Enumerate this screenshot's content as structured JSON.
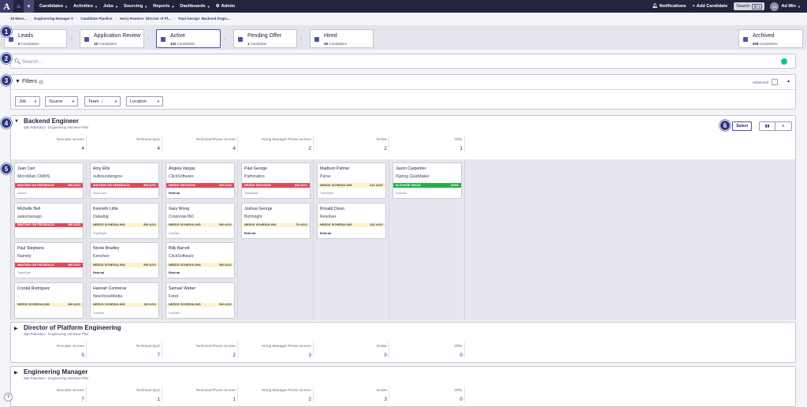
{
  "nav": {
    "logo": "A",
    "home_icon": "home-icon",
    "items": [
      "Candidates",
      "Activities",
      "Jobs",
      "Sourcing",
      "Reports",
      "Dashboards",
      "Admin"
    ],
    "notifications": "Notifications",
    "add_candidate": "Add Candidate",
    "search_label": "Search",
    "search_shortcut": "⌘+K",
    "user_initials": "AD",
    "user_name": "Ad Min"
  },
  "breadcrumb": [
    "16 More...",
    "Engineering Manager II",
    "Candidate Pipeline",
    "Harry Romero: Director of Pl...",
    "Paul George: Backend Engin..."
  ],
  "stages": [
    {
      "name": "Leads",
      "count": "0",
      "unit": "Candidates"
    },
    {
      "name": "Application Review",
      "count": "15",
      "unit": "Candidates"
    },
    {
      "name": "Active",
      "count": "122",
      "unit": "Candidates"
    },
    {
      "name": "Pending Offer",
      "count": "1",
      "unit": "Candidate"
    },
    {
      "name": "Hired",
      "count": "39",
      "unit": "Candidates"
    },
    {
      "name": "Archived",
      "count": "928",
      "unit": "Candidates"
    }
  ],
  "badges": [
    "1",
    "2",
    "3",
    "4",
    "5",
    "6"
  ],
  "search": {
    "placeholder": "Search..."
  },
  "filters": {
    "title": "Filters",
    "advanced": "Advanced",
    "dropdowns": [
      "Job",
      "Source",
      "Team",
      "Location"
    ]
  },
  "stage_headers": [
    "Recruiter Screen",
    "Technical Quiz",
    "Technical Phone Screen",
    "Hiring Manager Phone Screen",
    "Onsite",
    "Offer"
  ],
  "jobs": [
    {
      "title": "Backend Engineer",
      "location": "San Francisco",
      "plan": "Engineering Interview Plan",
      "counts": [
        "4",
        "4",
        "4",
        "2",
        "2",
        "1"
      ]
    },
    {
      "title": "Director of Platform Engineering",
      "location": "San Francisco",
      "plan": "Engineering Interview Plan",
      "counts": [
        "5",
        "7",
        "2",
        "3",
        "0",
        "0"
      ]
    },
    {
      "title": "Engineering Manager",
      "location": "San Francisco",
      "plan": "Engineering Interview Plan",
      "counts": [
        "7",
        "1",
        "1",
        "2",
        "3",
        "0"
      ]
    }
  ],
  "select_label": "Select",
  "board": [
    [
      {
        "name": "Juan Carr",
        "company": "MicroMain CMMS",
        "status": "WAITING ON FEEDBACK",
        "age": "5W AGO",
        "tone": "red",
        "source": "Indeed"
      },
      {
        "name": "Michelle Bell",
        "company": "salesmanago",
        "status": "WAITING ON FEEDBACK",
        "age": "5W AGO",
        "tone": "red",
        "source": ""
      },
      {
        "name": "Paul Stephens",
        "company": "Namely",
        "status": "WAITING ON FEEDBACK",
        "age": "5W AGO",
        "tone": "red",
        "source": "TripleByte"
      },
      {
        "name": "Crystal Rodriguez",
        "company": "-",
        "status": "NEEDS SCHEDULING",
        "age": "4W AGO",
        "tone": "yellow",
        "source": ""
      }
    ],
    [
      {
        "name": "Amy Ellis",
        "company": "outboundengine",
        "status": "WAITING ON FEEDBACK",
        "age": "5W AGO",
        "tone": "red",
        "source": "Hired.com"
      },
      {
        "name": "Kenneth Little",
        "company": "Datadog",
        "status": "NEEDS SCHEDULING",
        "age": "5W AGO",
        "tone": "yellow",
        "source": "TripleByte"
      },
      {
        "name": "Nicole Bradley",
        "company": "Kenshoo",
        "status": "NEEDS SCHEDULING",
        "age": "5W AGO",
        "tone": "yellow",
        "source": "Referral"
      },
      {
        "name": "Hannah Contreras",
        "company": "NewVoiceMedia",
        "status": "NEEDS SCHEDULING",
        "age": "1W AGO",
        "tone": "yellow",
        "source": "LinkedIn"
      }
    ],
    [
      {
        "name": "Angela Vargas",
        "company": "ClickSoftware",
        "status": "NEEDS DECISION",
        "age": "5W AGO",
        "tone": "red",
        "source": "Referral"
      },
      {
        "name": "Gary Wong",
        "company": "Corporate360",
        "status": "NEEDS SCHEDULING",
        "age": "5W AGO",
        "tone": "yellow",
        "source": "LinkedIn"
      },
      {
        "name": "Billy Barrett",
        "company": "ClickSoftware",
        "status": "NEEDS SCHEDULING",
        "age": "5W AGO",
        "tone": "yellow",
        "source": "Referral"
      },
      {
        "name": "Samuel Weber",
        "company": "Fond",
        "status": "NEEDS SCHEDULING",
        "age": "5W AGO",
        "tone": "yellow",
        "source": "LinkedIn"
      }
    ],
    [
      {
        "name": "Paul George",
        "company": "Pathmatics",
        "status": "NEEDS DECISION",
        "age": "5W AGO",
        "tone": "red",
        "source": "TripleByte"
      },
      {
        "name": "Joshua George",
        "company": "BizInsight",
        "status": "NEEDS SCHEDULING",
        "age": "7S AGO",
        "tone": "yellow",
        "source": "Referral"
      }
    ],
    [
      {
        "name": "Madison Palmer",
        "company": "Parse",
        "status": "NEEDS SCHEDULING",
        "age": "21S AGO",
        "tone": "yellow",
        "source": "TripleByte"
      },
      {
        "name": "Ronald Dixon",
        "company": "Resolver",
        "status": "NEEDS SCHEDULING",
        "age": "12S AGO",
        "tone": "yellow",
        "source": "Referral"
      }
    ],
    [
      {
        "name": "Jason Carpenter",
        "company": "iSpring QuizMaker",
        "status": "IN STAGE SINCE",
        "age": "NOW",
        "tone": "green",
        "source": "LinkedIn"
      }
    ]
  ],
  "help": "?"
}
